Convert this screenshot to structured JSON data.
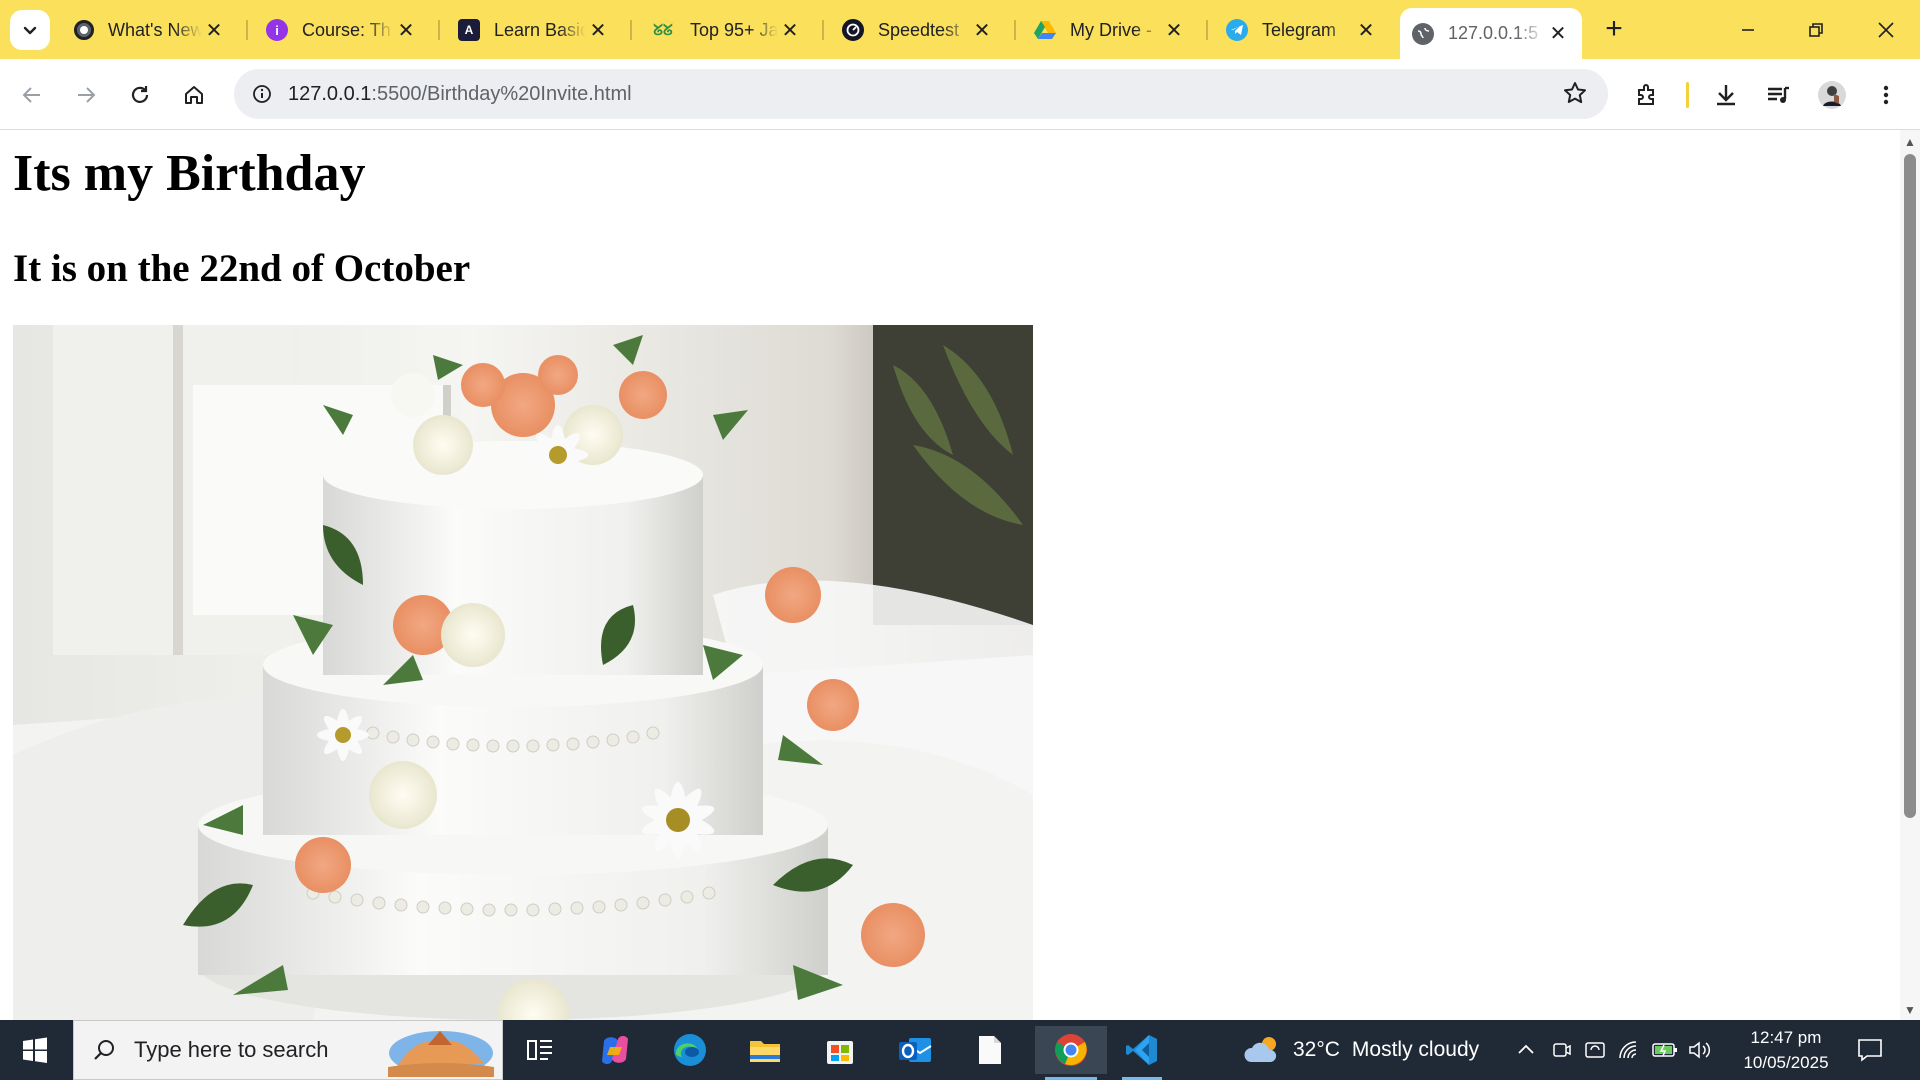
{
  "browser": {
    "tabs": [
      {
        "title": "What's New",
        "favicon": "chrome-icon",
        "color": "#5f6368"
      },
      {
        "title": "Course: Th",
        "favicon": "course-icon",
        "color": "#9334e6"
      },
      {
        "title": "Learn Basic",
        "favicon": "learn-icon",
        "color": "#1b1b3a"
      },
      {
        "title": "Top 95+ Ja",
        "favicon": "gfg-icon",
        "color": "#2f8d46"
      },
      {
        "title": "Speedtest",
        "favicon": "speedtest-icon",
        "color": "#141526"
      },
      {
        "title": "My Drive -",
        "favicon": "drive-icon",
        "color": "#1fa463"
      },
      {
        "title": "Telegram",
        "favicon": "telegram-icon",
        "color": "#2aabee"
      },
      {
        "title": "127.0.0.1:5",
        "favicon": "globe-icon",
        "color": "#5f6368"
      }
    ],
    "active_tab_index": 7,
    "url_host": "127.0.0.1",
    "url_path": ":5500/Birthday%20Invite.html"
  },
  "page": {
    "heading": "Its my Birthday",
    "subheading": "It is on the 22nd of October",
    "image_desc_icon": "cake-photo"
  },
  "taskbar": {
    "search_placeholder": "Type here to search",
    "weather_temp": "32°C",
    "weather_text": "Mostly cloudy",
    "time": "12:47 pm",
    "date": "10/05/2025"
  },
  "colors": {
    "tabstrip": "#fbe15b",
    "taskbar": "#202a36"
  }
}
